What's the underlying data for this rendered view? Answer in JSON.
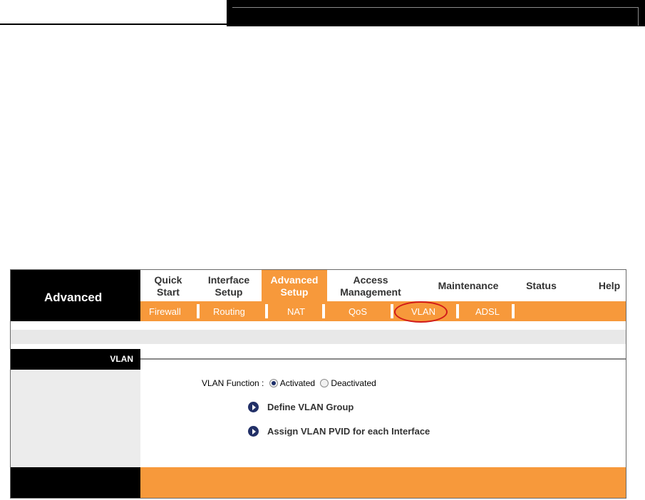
{
  "brand": {
    "label": "Advanced"
  },
  "main_nav": [
    {
      "line1": "Quick",
      "line2": "Start",
      "active": false
    },
    {
      "line1": "Interface",
      "line2": "Setup",
      "active": false
    },
    {
      "line1": "Advanced",
      "line2": "Setup",
      "active": true
    },
    {
      "line1": "Access",
      "line2": "Management",
      "active": false
    },
    {
      "label": "Maintenance",
      "active": false
    },
    {
      "label": "Status",
      "active": false
    },
    {
      "label": "Help",
      "active": false
    }
  ],
  "sub_nav": [
    "Firewall",
    "Routing",
    "NAT",
    "QoS",
    "VLAN",
    "ADSL"
  ],
  "section": {
    "title": "VLAN"
  },
  "vlan_function": {
    "label": "VLAN Function :",
    "options": [
      "Activated",
      "Deactivated"
    ],
    "selected": "Activated"
  },
  "links": {
    "define_group": "Define VLAN Group",
    "assign_pvid": "Assign VLAN PVID for each Interface"
  },
  "colors": {
    "accent": "#f7993b",
    "dark": "#000000",
    "highlight_circle": "#d11a1a",
    "bullet": "#223067"
  }
}
